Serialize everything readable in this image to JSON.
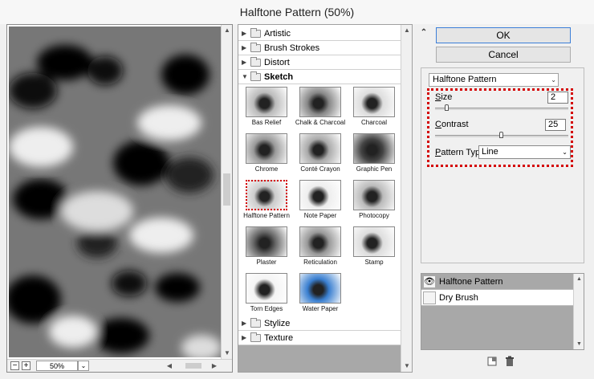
{
  "window": {
    "title": "Halftone Pattern (50%)"
  },
  "preview": {
    "zoom": "50%",
    "zoom_out": "−",
    "zoom_in": "+"
  },
  "gallery": {
    "categories_top": [
      {
        "label": "Artistic",
        "expanded": false
      },
      {
        "label": "Brush Strokes",
        "expanded": false
      },
      {
        "label": "Distort",
        "expanded": false
      },
      {
        "label": "Sketch",
        "expanded": true
      }
    ],
    "sketch_filters": [
      "Bas Relief",
      "Chalk & Charcoal",
      "Charcoal",
      "Chrome",
      "Conté Crayon",
      "Graphic Pen",
      "Halftone Pattern",
      "Note Paper",
      "Photocopy",
      "Plaster",
      "Reticulation",
      "Stamp",
      "Torn Edges",
      "Water Paper"
    ],
    "selected_filter": "Halftone Pattern",
    "categories_bottom": [
      {
        "label": "Stylize",
        "expanded": false
      },
      {
        "label": "Texture",
        "expanded": false
      }
    ]
  },
  "buttons": {
    "ok": "OK",
    "cancel": "Cancel"
  },
  "settings": {
    "filter": "Halftone Pattern",
    "size": {
      "label_key": "S",
      "label_rest": "ize",
      "value": "2",
      "min": 1,
      "max": 12
    },
    "contrast": {
      "label_key": "C",
      "label_rest": "ontrast",
      "value": "25",
      "min": 0,
      "max": 50
    },
    "pattern_type": {
      "label_key": "P",
      "label_rest": "attern Type:",
      "value": "Line"
    }
  },
  "layers": [
    {
      "name": "Halftone Pattern",
      "visible": true,
      "selected": true
    },
    {
      "name": "Dry Brush",
      "visible": false,
      "selected": false
    }
  ],
  "colors": {
    "highlight": "#d40000",
    "ok_border": "#3c7fd8",
    "layer_selected": "#a8a8a8"
  },
  "icons": {
    "new_layer": "new-effect-layer-icon",
    "delete_layer": "trash-icon",
    "collapse": "double-chevron-up-icon"
  }
}
